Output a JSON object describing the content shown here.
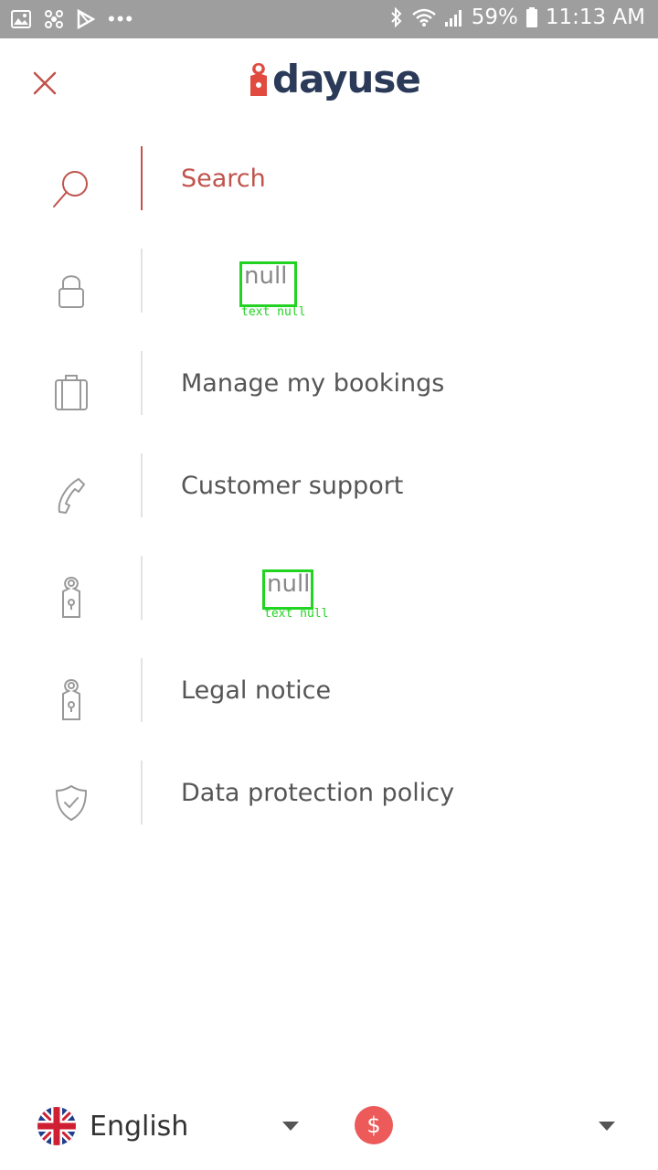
{
  "status_bar": {
    "battery": "59%",
    "time": "11:13 AM",
    "more": "•••"
  },
  "header": {
    "logo_text": "dayuse",
    "close_icon": "close-icon"
  },
  "menu": {
    "items": [
      {
        "label": "Search",
        "icon": "search-icon",
        "active": true
      },
      {
        "label": "null",
        "caption": "text null",
        "icon": "lock-icon"
      },
      {
        "label": "Manage my bookings",
        "icon": "suitcase-icon"
      },
      {
        "label": "Customer support",
        "icon": "phone-icon"
      },
      {
        "label": "null",
        "caption": "text null",
        "icon": "door-hanger-icon"
      },
      {
        "label": "Legal notice",
        "icon": "door-hanger-icon"
      },
      {
        "label": "Data protection policy",
        "icon": "shield-check-icon"
      }
    ]
  },
  "footer": {
    "language": "English",
    "currency_symbol": "$"
  },
  "colors": {
    "accent": "#c0534c",
    "brand_dark": "#2a3a58",
    "currency_badge": "#ec5a5a",
    "debug_box": "#22d322"
  }
}
